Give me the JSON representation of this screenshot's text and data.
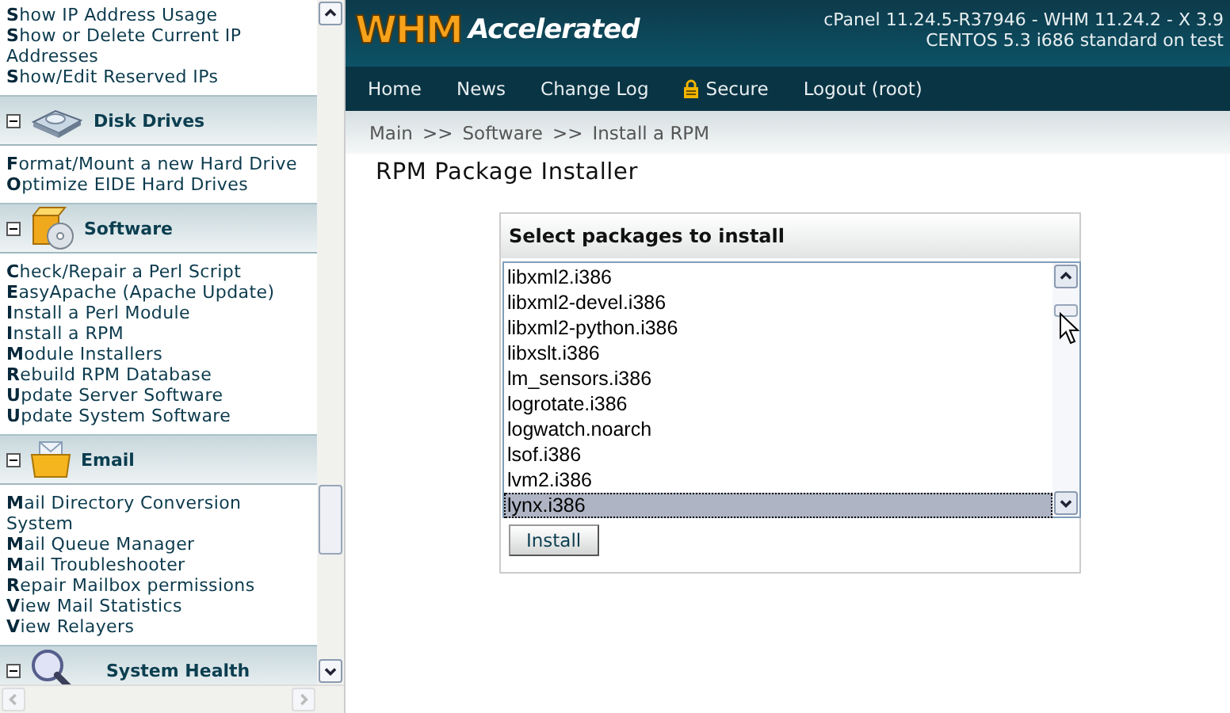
{
  "sidebar": {
    "top_items": [
      "**S**how IP Address Usage",
      "**S**how or Delete Current IP Addresses",
      "**S**how/Edit Reserved IPs"
    ],
    "sections": [
      {
        "title": "Disk Drives",
        "expanded": true,
        "items": [
          "**F**ormat/Mount a new Hard Drive",
          "**O**ptimize EIDE Hard Drives"
        ]
      },
      {
        "title": "Software",
        "expanded": true,
        "items": [
          "**C**heck/Repair a Perl Script",
          "**E**asyApache (Apache Update)",
          "**I**nstall a Perl Module",
          "**I**nstall a RPM",
          "**M**odule Installers",
          "**R**ebuild RPM Database",
          "**U**pdate Server Software",
          "**U**pdate System Software"
        ]
      },
      {
        "title": "Email",
        "expanded": true,
        "items": [
          "**M**ail Directory Conversion System",
          "**M**ail Queue Manager",
          "**M**ail Troubleshooter",
          "**R**epair Mailbox permissions",
          "**V**iew Mail Statistics",
          "**V**iew Relayers"
        ]
      },
      {
        "title": "System Health",
        "expanded": true
      }
    ]
  },
  "header": {
    "logo": "WHM",
    "logo_tagline": "Accelerated",
    "version_lines": [
      "cPanel 11.24.5-R37946 - WHM 11.24.2 - X 3.9",
      "CENTOS 5.3 i686 standard on test"
    ]
  },
  "nav": [
    {
      "label": "Home",
      "kind": "link"
    },
    {
      "label": "News",
      "kind": "link"
    },
    {
      "label": "Change Log",
      "kind": "link"
    },
    {
      "label": "Secure",
      "kind": "secure"
    },
    {
      "label": "Logout (root)",
      "kind": "link"
    }
  ],
  "breadcrumb": {
    "separator": ">>",
    "crumbs": [
      "Main",
      "Software",
      "Install a RPM"
    ]
  },
  "page_title": "RPM Package Installer",
  "installer": {
    "heading": "Select packages to install",
    "packages": [
      {
        "label": "libxml2.i386",
        "selected": false
      },
      {
        "label": "libxml2-devel.i386",
        "selected": false
      },
      {
        "label": "libxml2-python.i386",
        "selected": false
      },
      {
        "label": "libxslt.i386",
        "selected": false
      },
      {
        "label": "lm_sensors.i386",
        "selected": false
      },
      {
        "label": "logrotate.i386",
        "selected": false
      },
      {
        "label": "logwatch.noarch",
        "selected": false
      },
      {
        "label": "lsof.i386",
        "selected": false
      },
      {
        "label": "lvm2.i386",
        "selected": false
      },
      {
        "label": "lynx.i386",
        "selected": true
      }
    ],
    "button": "Install"
  }
}
